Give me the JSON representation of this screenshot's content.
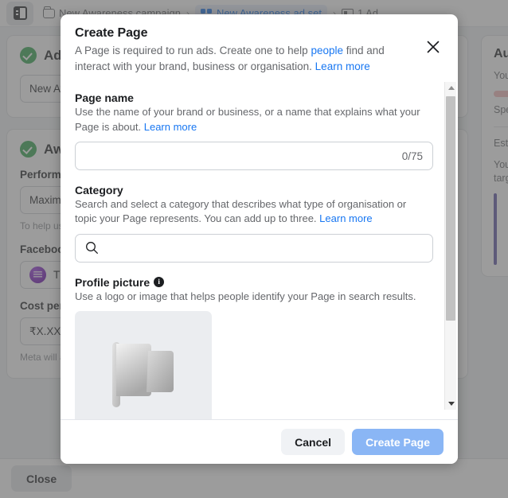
{
  "background": {
    "panel_toggle_icon": "panel-toggle-icon",
    "breadcrumbs": [
      {
        "label": "New Awareness campaign",
        "icon": "folder-icon",
        "active": false
      },
      {
        "label": "New Awareness ad set",
        "icon": "adset-squares-icon",
        "active": true
      },
      {
        "label": "1 Ad",
        "icon": "ad-icon",
        "active": false
      }
    ],
    "separator": "›",
    "cards": [
      {
        "title": "Ad set name",
        "status_icon": "green-check-icon",
        "input_value": "New Awareness ad set"
      },
      {
        "title": "Awareness",
        "status_icon": "green-check-icon",
        "performance_label": "Performance goal",
        "performance_value": "Maximise reach of ads",
        "performance_help": "To help us get the best results, tell us what you want to achieve.",
        "page_label": "Facebook Page",
        "page_value": "The Business Page",
        "cost_label": "Cost per result goal",
        "cost_value": "₹X.XX",
        "cost_help": "Meta will aim to spend your entire budget and get the highest value."
      }
    ],
    "close_button": "Close",
    "right_panel": {
      "title": "Audience definition",
      "line1": "Your audience selection is fairly broad.",
      "line2": "Specific",
      "line3": "Estimated audience size",
      "line4": "Your estimated audience size is based on your targeting selections."
    }
  },
  "modal": {
    "title": "Create Page",
    "description_part1": "A Page is required to run ads. Create one to help ",
    "description_link1": "people",
    "description_part2": " find and interact with your brand, business or organisation. ",
    "description_link2": "Learn more",
    "close_icon": "close-icon",
    "fields": {
      "page_name": {
        "label": "Page name",
        "help_text": "Use the name of your brand or business, or a name that explains what your Page is about. ",
        "help_link": "Learn more",
        "value": "",
        "counter": "0/75"
      },
      "category": {
        "label": "Category",
        "help_text": "Search and select a category that describes what type of organisation or topic your Page represents. You can add up to three. ",
        "help_link": "Learn more",
        "value": "",
        "search_icon": "search-icon"
      },
      "profile_picture": {
        "label": "Profile picture",
        "info_icon": "info-icon",
        "info_char": "i",
        "help_text": "Use a logo or image that helps people identify your Page in search results.",
        "placeholder_icon": "flag-placeholder-icon"
      }
    },
    "scrollbar": {
      "up_arrow": "scroll-up-arrow",
      "down_arrow": "scroll-down-arrow"
    },
    "footer": {
      "cancel_label": "Cancel",
      "submit_label": "Create Page",
      "submit_disabled": true
    }
  },
  "colors": {
    "accent_blue": "#1877f2",
    "primary_disabled": "#8ab6f5",
    "success_green": "#31a24c",
    "overlay": "#606060",
    "text_primary": "#1c1e21",
    "text_secondary": "#65676b"
  }
}
